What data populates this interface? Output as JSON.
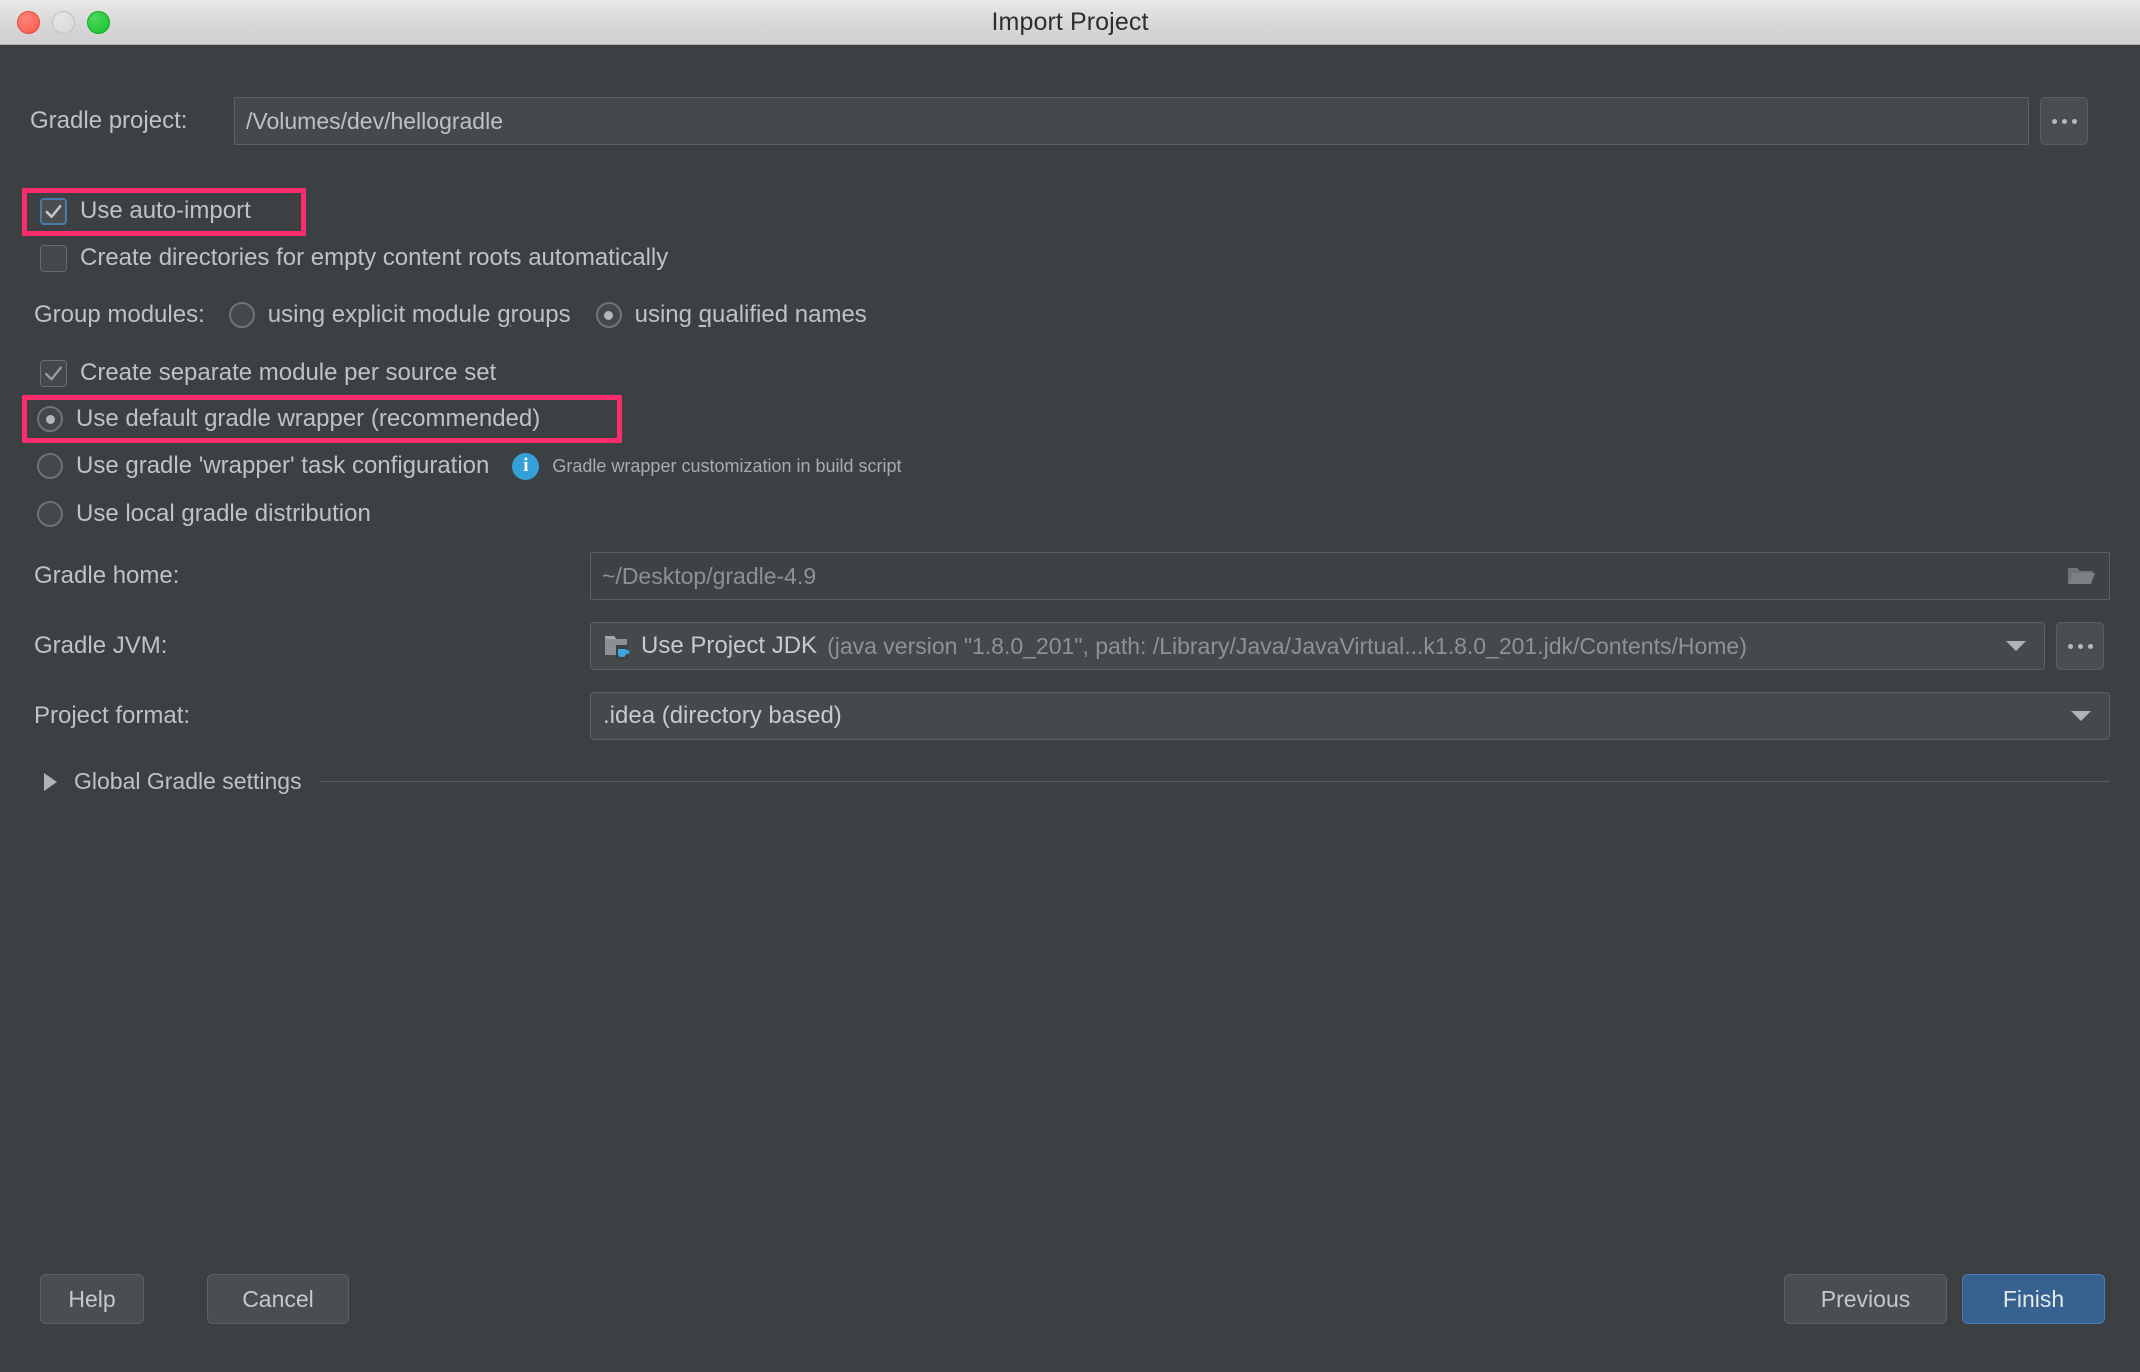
{
  "window": {
    "title": "Import Project",
    "traffic_lights": [
      "close-button",
      "minimize-button",
      "maximize-button"
    ]
  },
  "fields": {
    "gradle_project": {
      "label": "Gradle project:",
      "value": "/Volumes/dev/hellogradle",
      "browse_label": "..."
    },
    "gradle_home": {
      "label": "Gradle home:",
      "value": "~/Desktop/gradle-4.9",
      "icon": "folder-icon"
    },
    "gradle_jvm": {
      "label": "Gradle JVM:",
      "icon": "jdk-folder-icon",
      "value_main": "Use Project JDK",
      "value_detail": "(java version \"1.8.0_201\", path: /Library/Java/JavaVirtual...k1.8.0_201.jdk/Contents/Home)",
      "browse_label": "..."
    },
    "project_format": {
      "label": "Project format:",
      "value": ".idea (directory based)"
    }
  },
  "checkboxes": [
    {
      "name": "use-auto-import",
      "label": "Use auto-import",
      "checked": true,
      "style": "blue",
      "highlighted": true
    },
    {
      "name": "create-directories-empty-content-roots",
      "label": "Create directories for empty content roots automatically",
      "checked": false,
      "style": "plain",
      "highlighted": false
    },
    {
      "name": "create-separate-module-per-source-set",
      "label": "Create separate module per source set",
      "checked": true,
      "style": "gray",
      "highlighted": false
    }
  ],
  "group_modules": {
    "label": "Group modules:",
    "options": [
      {
        "name": "using-explicit-module-groups",
        "label_pre": "using explicit module ",
        "mnemonic": "g",
        "label_post": "roups",
        "selected": false
      },
      {
        "name": "using-qualified-names",
        "label_pre": "using ",
        "mnemonic": "q",
        "label_post": "ualified names",
        "selected": true
      }
    ]
  },
  "distribution_radios": [
    {
      "name": "use-default-gradle-wrapper",
      "label": "Use default gradle wrapper (recommended)",
      "selected": true,
      "highlighted": true,
      "hint": null
    },
    {
      "name": "use-gradle-wrapper-task-configuration",
      "label": "Use gradle 'wrapper' task configuration",
      "selected": false,
      "highlighted": false,
      "hint": "Gradle wrapper customization in build script"
    },
    {
      "name": "use-local-gradle-distribution",
      "label": "Use local gradle distribution",
      "selected": false,
      "highlighted": false,
      "hint": null
    }
  ],
  "global_settings": {
    "label": "Global Gradle settings",
    "expanded": false
  },
  "buttons": {
    "help": "Help",
    "cancel": "Cancel",
    "previous": "Previous",
    "finish": "Finish"
  },
  "colors": {
    "highlight": "#fd2d6d",
    "dialog_bg": "#3c4043",
    "accent_blue": "#37618f",
    "info_blue": "#35a0d8"
  }
}
